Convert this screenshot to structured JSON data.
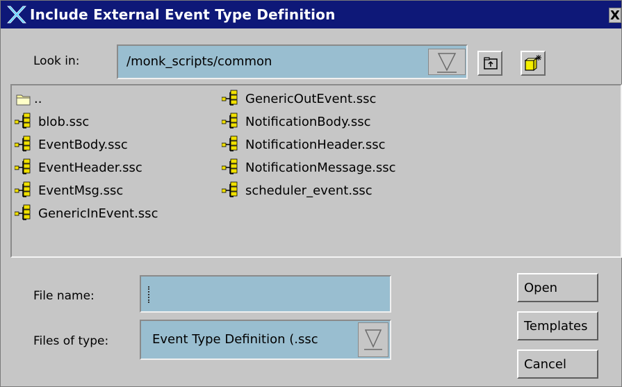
{
  "dialog": {
    "title": "Include External Event Type Definition",
    "close_label": "X"
  },
  "look_in": {
    "label": "Look in:",
    "value": "/monk_scripts/common",
    "up_folder_icon": "up-one-level-folder-icon",
    "new_folder_icon": "new-folder-icon"
  },
  "files": {
    "column1": [
      {
        "name": "..",
        "icon": "folder-icon"
      },
      {
        "name": "blob.ssc",
        "icon": "event-type-icon"
      },
      {
        "name": "EventBody.ssc",
        "icon": "event-type-icon"
      },
      {
        "name": "EventHeader.ssc",
        "icon": "event-type-icon"
      },
      {
        "name": "EventMsg.ssc",
        "icon": "event-type-icon"
      },
      {
        "name": "GenericInEvent.ssc",
        "icon": "event-type-icon"
      }
    ],
    "column2": [
      {
        "name": "GenericOutEvent.ssc",
        "icon": "event-type-icon"
      },
      {
        "name": "NotificationBody.ssc",
        "icon": "event-type-icon"
      },
      {
        "name": "NotificationHeader.ssc",
        "icon": "event-type-icon"
      },
      {
        "name": "NotificationMessage.ssc",
        "icon": "event-type-icon"
      },
      {
        "name": "scheduler_event.ssc",
        "icon": "event-type-icon"
      }
    ]
  },
  "file_name": {
    "label": "File name:",
    "value": ""
  },
  "file_type": {
    "label": "Files of type:",
    "value": "Event Type Definition (.ssc"
  },
  "buttons": {
    "open": "Open",
    "templates": "Templates",
    "cancel": "Cancel"
  },
  "colors": {
    "titlebar": "#0e1878",
    "field": "#99bed0",
    "dialog": "#c6c6c6"
  }
}
